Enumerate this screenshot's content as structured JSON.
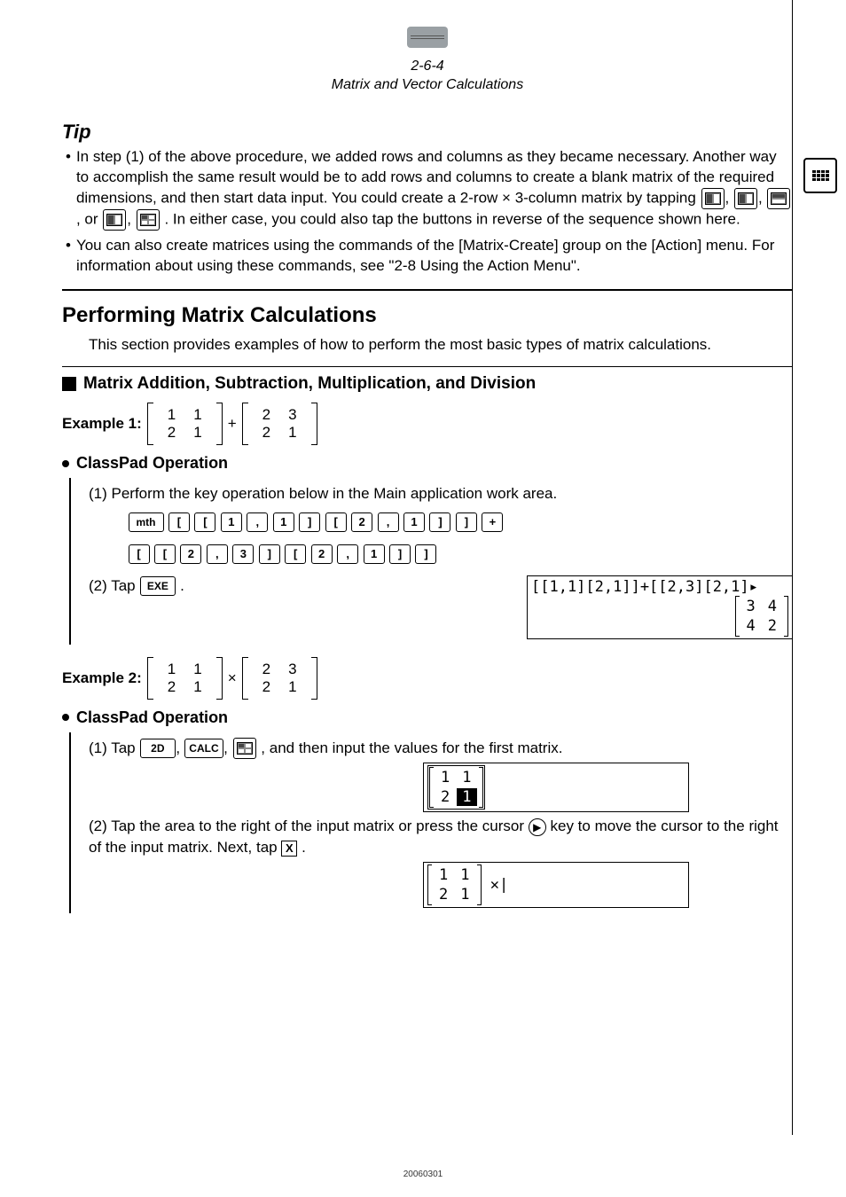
{
  "header": {
    "page_ref": "2-6-4",
    "title": "Matrix and Vector Calculations"
  },
  "tip": {
    "heading": "Tip",
    "bullet1_a": "In step (1) of the above procedure, we added rows and columns as they became necessary. Another way to accomplish the same result would be to add rows and columns to create a blank matrix of the required dimensions, and then start data input. You could create a 2-row × 3-column matrix by tapping ",
    "bullet1_b": ", or ",
    "bullet1_c": ". In either case, you could also tap the buttons in reverse of the sequence shown here.",
    "bullet2": "You can also create matrices using the commands of the [Matrix-Create] group on the [Action] menu. For information about using these commands, see \"2-8 Using the Action Menu\"."
  },
  "section": {
    "title": "Performing Matrix Calculations",
    "intro": "This section provides examples of how to perform the most basic types of matrix calculations."
  },
  "subsection": {
    "title": "Matrix Addition, Subtraction, Multiplication, and Division"
  },
  "ex1": {
    "label": "Example 1:",
    "m1": [
      [
        "1",
        "1"
      ],
      [
        "2",
        "1"
      ]
    ],
    "op": "+",
    "m2": [
      [
        "2",
        "3"
      ],
      [
        "2",
        "1"
      ]
    ]
  },
  "ex2": {
    "label": "Example 2:",
    "m1": [
      [
        "1",
        "1"
      ],
      [
        "2",
        "1"
      ]
    ],
    "op": "×",
    "m2": [
      [
        "2",
        "3"
      ],
      [
        "2",
        "1"
      ]
    ]
  },
  "op_titles": {
    "classpad1": "ClassPad Operation",
    "classpad2": "ClassPad Operation"
  },
  "steps1": {
    "text1": "(1) Perform the key operation below in the Main application work area.",
    "keys_row1": [
      "mth",
      "[",
      "[",
      "1",
      ",",
      "1",
      "]",
      "[",
      "2",
      ",",
      "1",
      "]",
      "]",
      "+"
    ],
    "keys_row2": [
      "[",
      "[",
      "2",
      ",",
      "3",
      "]",
      "[",
      "2",
      ",",
      "1",
      "]",
      "]"
    ],
    "text2a": "(2) Tap ",
    "exe": "EXE",
    "text2b": "."
  },
  "screen1": {
    "line1": "[[1,1][2,1]]+[[2,3][2,1]▸",
    "result": [
      [
        "3",
        "4"
      ],
      [
        "4",
        "2"
      ]
    ]
  },
  "steps2": {
    "text1a": "(1) Tap ",
    "k2d": "2D",
    "kcalc": "CALC",
    "text1b": ", and then input the values for the first matrix.",
    "screenA": [
      [
        "1",
        "1"
      ],
      [
        "2",
        "1"
      ]
    ],
    "text2a": "(2) Tap the area to the right of the input matrix or press the cursor ",
    "text2b": " key to move the cursor to the right of the input matrix. Next, tap ",
    "text2c": ".",
    "boxX": "X",
    "screenB": [
      [
        "1",
        "1"
      ],
      [
        "2",
        "1"
      ]
    ],
    "cursor_glyph": "✕|"
  },
  "footer": "20060301"
}
